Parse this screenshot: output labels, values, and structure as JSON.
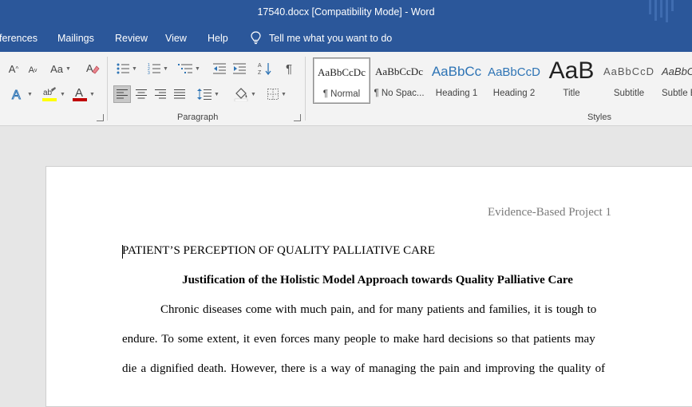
{
  "window": {
    "title": "17540.docx [Compatibility Mode]  -  Word"
  },
  "menu": {
    "tabs": [
      "ferences",
      "Mailings",
      "Review",
      "View",
      "Help"
    ],
    "tell_me": "Tell me what you want to do"
  },
  "ribbon": {
    "font_group": {
      "change_case": "Aa",
      "font_color_letter": "A"
    },
    "paragraph_group": {
      "label": "Paragraph"
    },
    "styles_group": {
      "label": "Styles",
      "items": [
        {
          "sample": "AaBbCcDc",
          "name": "¶ Normal",
          "active": true
        },
        {
          "sample": "AaBbCcDc",
          "name": "¶ No Spac..."
        },
        {
          "sample": "AaBbCc",
          "name": "Heading 1"
        },
        {
          "sample": "AaBbCcD",
          "name": "Heading 2"
        },
        {
          "sample": "AaB",
          "name": "Title"
        },
        {
          "sample": "AaBbCcD",
          "name": "Subtitle"
        },
        {
          "sample": "AaBbCcD",
          "name": "Subtle E"
        }
      ]
    }
  },
  "colors": {
    "word_blue": "#2b579a",
    "heading_blue": "#2e74b5",
    "highlight_yellow": "#ffff00",
    "font_red": "#c00000"
  },
  "document": {
    "header": "Evidence-Based Project 1",
    "title": "PATIENT’S PERCEPTION OF QUALITY PALLIATIVE CARE",
    "heading": "Justification of the Holistic Model Approach towards Quality Palliative Care",
    "paragraph_lines": [
      "Chronic diseases come with much pain, and for many patients and families, it is tough to",
      "endure. To some extent, it even forces many people to make hard decisions so that patients may",
      "die a dignified death. However, there is a way of managing the pain and improving the quality of"
    ]
  }
}
